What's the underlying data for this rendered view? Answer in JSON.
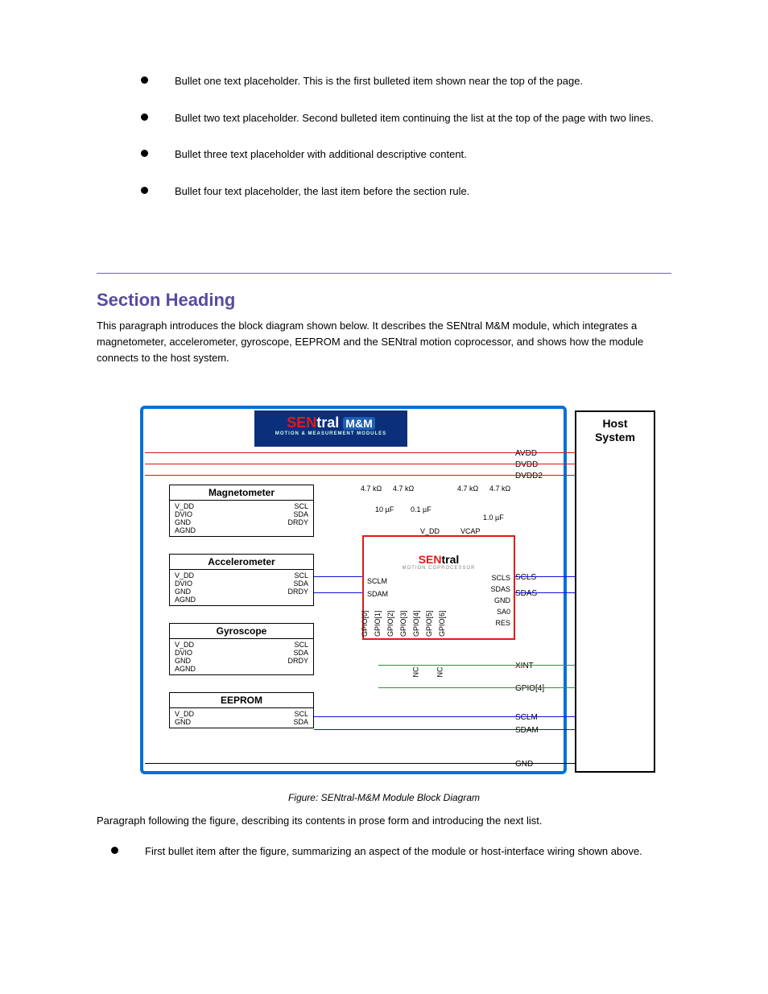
{
  "bullets": {
    "b1": "Bullet one text placeholder. This is the first bulleted item shown near the top of the page.",
    "b2": "Bullet two text placeholder. Second bulleted item continuing the list at the top of the page with two lines.",
    "b3": "Bullet three text placeholder with additional descriptive content.",
    "b4": "Bullet four text placeholder, the last item before the section rule."
  },
  "section_title": "Section Heading",
  "section_para": "This paragraph introduces the block diagram shown below. It describes the SENtral M&M module, which integrates a magnetometer, accelerometer, gyroscope, EEPROM and the SENtral motion coprocessor, and shows how the module connects to the host system.",
  "brand": {
    "sen": "SEN",
    "tral": "tral",
    "mm": "M&M",
    "sub": "MOTION & MEASUREMENT MODULES"
  },
  "host": {
    "l1": "Host",
    "l2": "System"
  },
  "right_signals": [
    "AVDD",
    "DVDD",
    "DVDD2",
    "SCLS",
    "SDAS",
    "XINT",
    "GPIO[4]",
    "SCLM",
    "SDAM",
    "GND"
  ],
  "resistors": {
    "r": "4.7 kΩ"
  },
  "caps": {
    "c1": "10 µF",
    "c2": "0.1 µF",
    "c3": "1.0 µF"
  },
  "sensors": {
    "mag": {
      "title": "Magnetometer",
      "pl": [
        "V_DD",
        "DVIO",
        "GND",
        "AGND"
      ],
      "pr": [
        "SCL",
        "SDA",
        "DRDY"
      ]
    },
    "accel": {
      "title": "Accelerometer",
      "pl": [
        "V_DD",
        "DVIO",
        "GND",
        "AGND"
      ],
      "pr": [
        "SCL",
        "SDA",
        "DRDY"
      ]
    },
    "gyro": {
      "title": "Gyroscope",
      "pl": [
        "V_DD",
        "DVIO",
        "GND",
        "AGND"
      ],
      "pr": [
        "SCL",
        "SDA",
        "DRDY"
      ]
    },
    "eep": {
      "title": "EEPROM",
      "pl": [
        "V_DD",
        "",
        "GND"
      ],
      "pr": [
        "SCL",
        "SDA"
      ]
    }
  },
  "chip": {
    "sen": "SEN",
    "tral": "tral",
    "sub": "MOTION COPROCESSOR",
    "top": [
      "V_DD",
      "VCAP"
    ],
    "left": [
      "SCLM",
      "SDAM"
    ],
    "right": [
      "SCLS",
      "SDAS",
      "GND",
      "SA0",
      "RES"
    ],
    "bottom": [
      "GPIO[0]",
      "GPIO[1]",
      "GPIO[2]",
      "GPIO[3]",
      "GPIO[4]",
      "GPIO[5]",
      "GPIO[6]"
    ],
    "nc": "NC"
  },
  "fig_caption": "Figure: SENtral-M&M Module Block Diagram",
  "after": {
    "p1": "Paragraph following the figure, describing its contents in prose form and introducing the next list.",
    "b1": "First bullet item after the figure, summarizing an aspect of the module or host-interface wiring shown above."
  },
  "colors": {
    "frame": "#0070d8",
    "chip": "#e11a1a",
    "power": "#d11",
    "i2c": "#11d",
    "int": "#1a9c3a",
    "gnd": "#000"
  }
}
